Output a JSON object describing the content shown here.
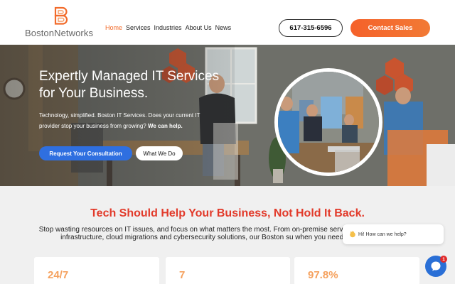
{
  "header": {
    "logo_text_bold": "Boston",
    "logo_text_light": "Networks",
    "nav": [
      {
        "label": "Home",
        "active": true
      },
      {
        "label": "Services",
        "active": false
      },
      {
        "label": "Industries",
        "active": false
      },
      {
        "label": "About Us",
        "active": false
      },
      {
        "label": "News",
        "active": false
      }
    ],
    "phone": "617-315-6596",
    "contact_label": "Contact Sales"
  },
  "hero": {
    "title": "Expertly Managed IT Services for Your Business.",
    "subtitle_pre": "Technology, simplified. Boston IT Services. Does your current IT provider stop your business from growing? ",
    "subtitle_strong": "We can help.",
    "primary_cta": "Request Your Consultation",
    "secondary_cta": "What We Do"
  },
  "section": {
    "title": "Tech Should Help Your Business, Not Hold It Back.",
    "text": "Stop wasting resources on IT issues, and focus on what matters the most. From on-premise serv your ideal hybrid cloud infrastructure, cloud migrations and cybersecurity solutions, our Boston su when you need on-site support.",
    "stats": [
      "24/7",
      "7",
      "97.8%"
    ]
  },
  "chat": {
    "greeting": "Hi! How can we help?",
    "badge_count": "1"
  },
  "colors": {
    "accent_orange": "#f26b2a",
    "headline_red": "#e23a2a",
    "cta_blue": "#2f6fe0",
    "stat_orange": "#f5a15e"
  },
  "icons": [
    "boston-networks-logo-icon",
    "waving-hand-icon",
    "chat-icon"
  ]
}
